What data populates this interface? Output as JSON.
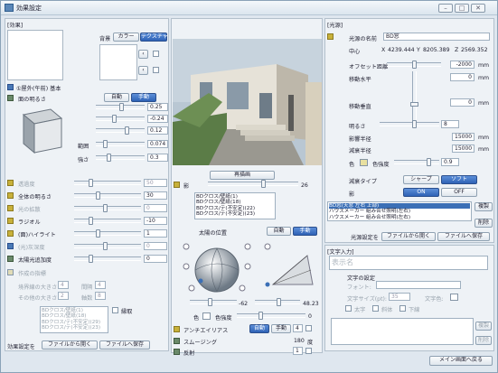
{
  "window": {
    "title": "効果設定"
  },
  "left": {
    "header": "[効果]",
    "bg_label": "背景",
    "bg_tabs": [
      "カラー",
      "テクスチャ"
    ],
    "preset_name": "①屋外(午前) 基本",
    "ambient_label": "面の明るさ",
    "auto": "自動",
    "manual": "手動",
    "cube_values": [
      "0.25",
      "-0.24",
      "0.12",
      "0.074",
      "0.3"
    ],
    "cube_labels": [
      "範囲",
      "強さ"
    ],
    "rows": [
      {
        "label": "透過度",
        "value": "50",
        "dim": true
      },
      {
        "label": "全体の明るさ",
        "value": "30",
        "dim": false
      },
      {
        "label": "光の拡散",
        "value": "0",
        "dim": true
      },
      {
        "label": "ラジオル",
        "value": "-10",
        "dim": false
      },
      {
        "label": "(面)ハイライト",
        "value": "1",
        "dim": false
      },
      {
        "label": "(光)灰深度",
        "value": "0",
        "dim": true
      },
      {
        "label": "太陽光追加度",
        "value": "0",
        "dim": false
      }
    ],
    "texture_header": "作成の指標",
    "boundary_size_label": "境界線の大きさ",
    "boundary_size_value": "4",
    "interval_label": "間隔",
    "interval_value": "4",
    "other_size_label": "その他の大きさ",
    "other_size_value": "2",
    "count_label": "軸数",
    "count_value": "8",
    "edge_label": "縁取",
    "list_items": [
      "BDクロス/壁紙(1)",
      "BDクロス/壁紙(18)",
      "BDクロス/テ(不安定)(29)",
      "BDクロス/テ(不安定)(23)"
    ],
    "footer_label": "効果設定を",
    "load_btn": "ファイルから開く",
    "save_btn": "ファイルへ保存"
  },
  "middle": {
    "redraw": "再描画",
    "shadow_label": "影",
    "shadow_value": "26",
    "list_items": [
      "BDクロス/壁紙(1)",
      "BDクロス/壁紙(18)",
      "BDクロス/テ(不安定)(22)",
      "BDクロス/テ(不安定)(23)"
    ],
    "sun_label": "太陽の位置",
    "auto": "自動",
    "manual": "手動",
    "sun_v1": "-62",
    "sun_v2": "48.23",
    "color_label": "色",
    "color_strength": "色強度",
    "color_value": "0",
    "aa_label": "アンチエイリアス",
    "aa_auto": "自動",
    "aa_manual": "手動",
    "aa_value": "4",
    "smooth_label": "スムージング",
    "smooth_value": "180",
    "smooth_unit": "度",
    "reflect_label": "反射",
    "reflect_value": "1"
  },
  "right": {
    "header": "[光源]",
    "light_name_label": "光源の名前",
    "light_name": "BD窓",
    "center_label": "中心",
    "x_label": "X",
    "x_value": "4239.444",
    "y_label": "Y",
    "y_value": "8205.389",
    "z_label": "Z",
    "z_value": "2569.352",
    "offset_label": "オフセット距離",
    "offset_value": "-2000",
    "mm": "mm",
    "move_h_label": "移動水平",
    "move_h_value": "0",
    "move_v_label": "移動垂直",
    "move_v_value": "0",
    "brightness_label": "明るさ",
    "brightness_value": "8",
    "atten_radius_label": "影響半径",
    "atten_radius_value": "15000",
    "fade_label": "減衰半径",
    "fade_value": "15000",
    "color_label": "色",
    "strength_label": "色強度",
    "strength_value": "0.9",
    "decay_label": "減衰タイプ",
    "decay_sharp": "シャープ",
    "decay_soft": "ソフト",
    "shadow_label": "影",
    "shadow_on": "ON",
    "shadow_off": "OFF",
    "list_items": [
      "BD窓(天窓 左右 上部)",
      "ハウスメーカー 組み合せ照明(左右)",
      "ハウスメーカー 組み合せ照明(左右)"
    ],
    "copy": "複製",
    "del": "削除",
    "light_setting_label": "光源設定を",
    "load_btn": "ファイルから開く",
    "save_btn": "ファイルへ保存",
    "text_header": "[文字入力]",
    "text_placeholder": "表示名",
    "font_section": "文字の設定",
    "font_label": "フォント:",
    "font_size_label": "文字サイズ(pt):",
    "font_size_value": "35",
    "text_color_label": "文字色:",
    "bold": "太字",
    "italic": "斜体",
    "underline": "下線",
    "copy2": "複製",
    "del2": "削除",
    "back_btn": "メイン画面へ戻る"
  }
}
